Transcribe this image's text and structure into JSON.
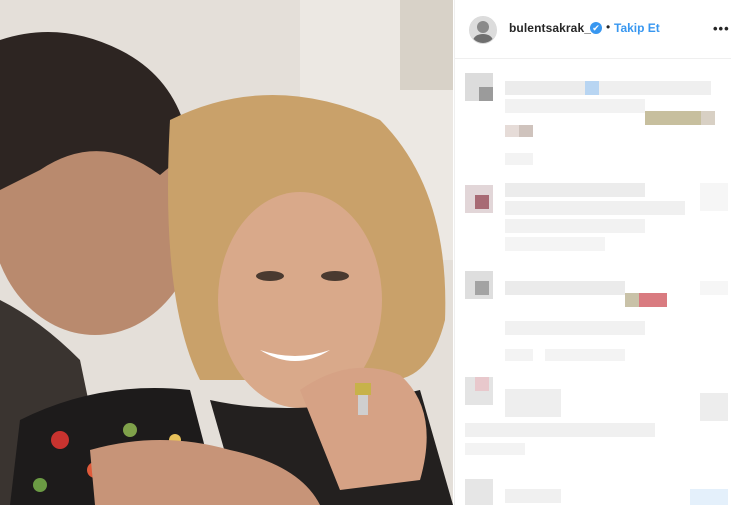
{
  "post": {
    "username": "bulentsakrak_",
    "verified_glyph": "✔",
    "separator": "•",
    "follow_label": "Takip Et",
    "more_label": "•••",
    "avatar_icon": "profile-avatar",
    "photo_icon": "post-photo"
  },
  "comments_blurred": true,
  "colors": {
    "follow_blue": "#3897f0",
    "verified_blue": "#3897f0",
    "text": "#262626",
    "border": "#efefef",
    "pixelation_gray": "#ececec"
  }
}
